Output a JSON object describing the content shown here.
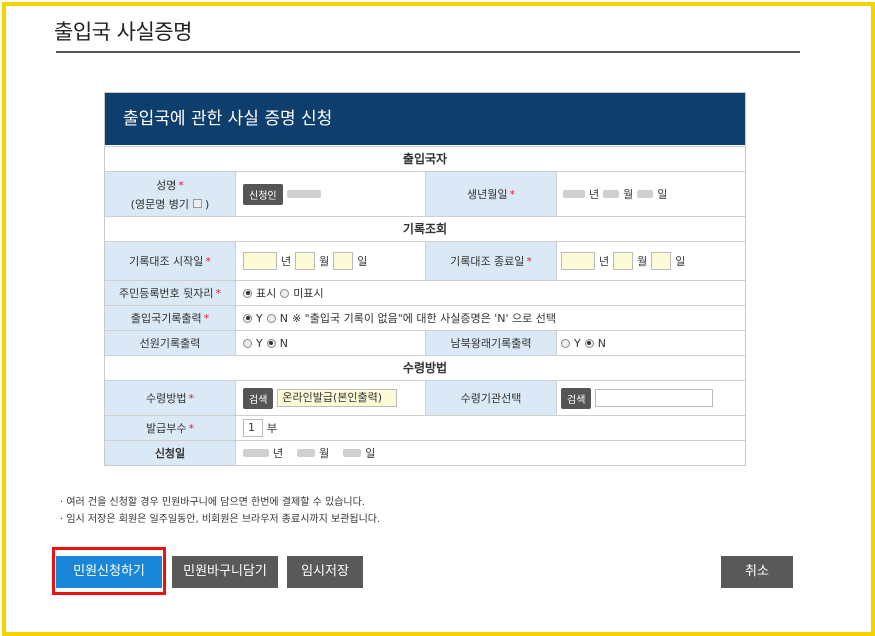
{
  "page": {
    "title": "출입국 사실증명"
  },
  "form": {
    "header": "출입국에 관한 사실 증명 신청",
    "sections": {
      "traveler": "출입국자",
      "record_query": "기록조회",
      "receive_method": "수령방법"
    },
    "name": {
      "label": "성명",
      "sublabel": "(영문명 병기",
      "sublabel_end": ")",
      "applicant_button": "신청인"
    },
    "birth": {
      "label": "생년월일",
      "year_unit": "년",
      "month_unit": "월",
      "day_unit": "일"
    },
    "record_start": {
      "label": "기록대조 시작일",
      "year_unit": "년",
      "month_unit": "월",
      "day_unit": "일"
    },
    "record_end": {
      "label": "기록대조 종료일",
      "year_unit": "년",
      "month_unit": "월",
      "day_unit": "일"
    },
    "rrn_back": {
      "label": "주민등록번호 뒷자리",
      "opt_show": "표시",
      "opt_hide": "미표시",
      "selected": "표시"
    },
    "immigration_output": {
      "label": "출입국기록출력",
      "opt_y": "Y",
      "opt_n": "N",
      "note": "※ \"출입국 기록이 없음\"에 대한 사실증명은 'N' 으로 선택",
      "selected": "N"
    },
    "crew_output": {
      "label": "선원기록출력",
      "opt_y": "Y",
      "opt_n": "N",
      "selected": "N"
    },
    "nk_output": {
      "label": "남북왕래기록출력",
      "opt_y": "Y",
      "opt_n": "N",
      "selected": "N"
    },
    "receive": {
      "label": "수령방법",
      "search_button": "검색",
      "value": "온라인발급(본인출력)"
    },
    "receive_org": {
      "label": "수령기관선택",
      "search_button": "검색",
      "value": ""
    },
    "copies": {
      "label": "발급부수",
      "value": "1",
      "unit": "부"
    },
    "apply_date": {
      "label": "신청일",
      "year_unit": "년",
      "month_unit": "월",
      "day_unit": "일"
    },
    "required_mark": "*"
  },
  "notes": [
    "· 여러 건을 신청할 경우 민원바구니에 담으면 한번에 결제할 수 있습니다.",
    "· 임시 저장은 회원은 일주일동안, 비회원은 브라우저 종료시까지 보관됩니다."
  ],
  "buttons": {
    "apply": "민원신청하기",
    "basket": "민원바구니담기",
    "temp_save": "임시저장",
    "cancel": "취소"
  },
  "colors": {
    "header_bg": "#0e3e6e",
    "label_bg": "#dbe8f5",
    "primary": "#1a86d8",
    "frame": "#f5d300",
    "highlight": "#ee1111"
  }
}
